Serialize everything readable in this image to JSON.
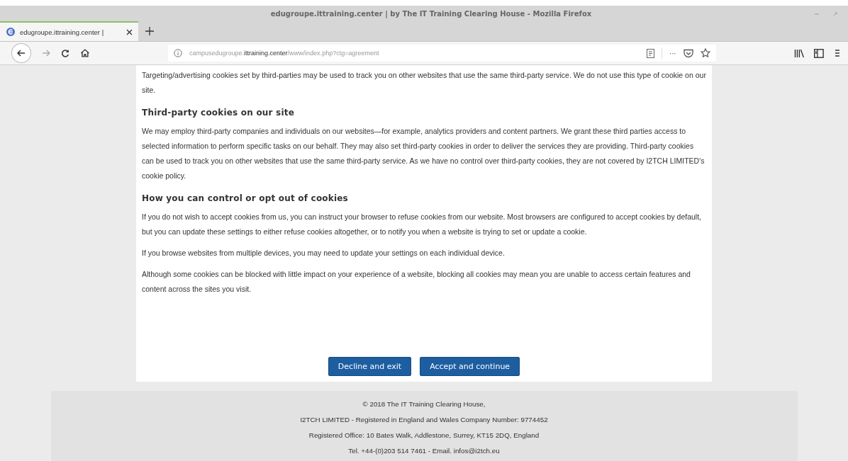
{
  "window": {
    "title": "edugroupe.ittraining.center | by The IT Training Clearing House - Mozilla Firefox"
  },
  "tabs": [
    {
      "label": "edugroupe.ittraining.center |",
      "selected": true
    }
  ],
  "address_bar": {
    "url_start": "campusedugroupe.",
    "url_domain": "ittraining.center",
    "url_path": "/www/index.php?ctg=agreement",
    "more": "···"
  },
  "content": [
    {
      "kind": "paragraph",
      "text": "Targeting/advertising cookies set by third-parties may be used to track you on other websites that use the same third-party service. We do not use this type of cookie on our site."
    },
    {
      "kind": "heading",
      "text": "Third-party cookies on our site"
    },
    {
      "kind": "paragraph",
      "text": "We may employ third-party companies and individuals on our websites—for example, analytics providers and content partners. We grant these third parties access to selected information to perform specific tasks on our behalf. They may also set third-party cookies in order to deliver the services they are providing. Third-party cookies can be used to track you on other websites that use the same third-party service. As we have no control over third-party cookies, they are not covered by I2TCH LIMITED's cookie policy."
    },
    {
      "kind": "heading",
      "text": "How you can control or opt out of cookies"
    },
    {
      "kind": "paragraph",
      "text": "If you do not wish to accept cookies from us, you can instruct your browser to refuse cookies from our website. Most browsers are configured to accept cookies by default, but you can update these settings to either refuse cookies altogether, or to notify you when a website is trying to set or update a cookie."
    },
    {
      "kind": "paragraph",
      "text": "If you browse websites from multiple devices, you may need to update your settings on each individual device."
    },
    {
      "kind": "paragraph",
      "text": "Although some cookies can be blocked with little impact on your experience of a website, blocking all cookies may mean you are unable to access certain features and content across the sites you visit."
    }
  ],
  "buttons": [
    "Decline and exit",
    "Accept and continue"
  ],
  "footer": [
    "© 2018 The IT Training Clearing House,",
    "I2TCH LIMITED - Registered in England and Wales Company Number: 9774452",
    "Registered Office: 10 Bates Walk, Addlestone, Surrey, KT15 2DQ, England",
    "Tel. +44-(0)203 514 7461 - Email. infos@i2tch.eu"
  ]
}
